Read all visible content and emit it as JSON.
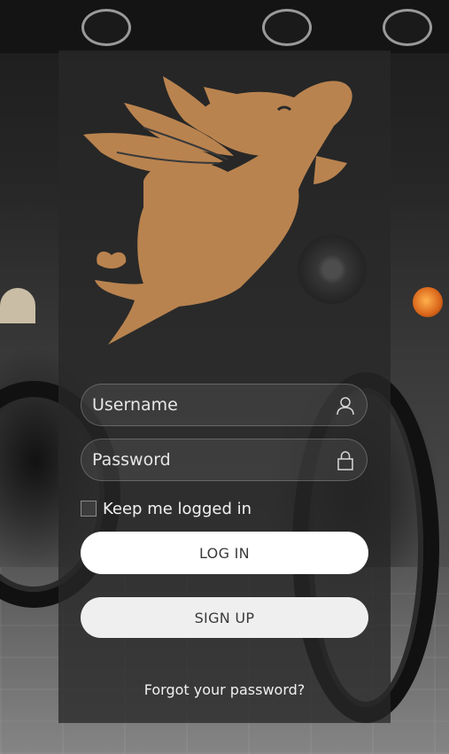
{
  "colors": {
    "brand": "#B9834F",
    "panel_overlay": "#282828",
    "button_background": "#FFFFFF",
    "button_text": "#3A3A3A"
  },
  "logo": {
    "icon": "flying-pig-logo"
  },
  "login_form": {
    "username": {
      "value": "",
      "placeholder": "Username",
      "icon": "user-icon"
    },
    "password": {
      "value": "",
      "placeholder": "Password",
      "icon": "lock-icon"
    },
    "remember_me": {
      "label": "Keep me logged in",
      "checked": false
    },
    "login_label": "LOG IN",
    "signup_label": "SIGN UP",
    "forgot_password_label": "Forgot your password?"
  }
}
